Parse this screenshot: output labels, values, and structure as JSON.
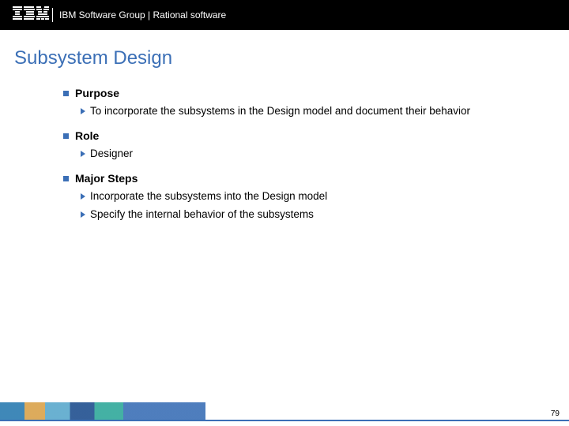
{
  "header": {
    "logo_label": "IBM",
    "text": "IBM Software Group | Rational software"
  },
  "title": "Subsystem Design",
  "sections": [
    {
      "label": "Purpose",
      "items": [
        "To incorporate the subsystems in the Design model and document their behavior"
      ]
    },
    {
      "label": "Role",
      "items": [
        "Designer"
      ]
    },
    {
      "label": "Major Steps",
      "items": [
        "Incorporate the subsystems into the Design model",
        "Specify the internal behavior of the subsystems"
      ]
    }
  ],
  "page_number": "79"
}
